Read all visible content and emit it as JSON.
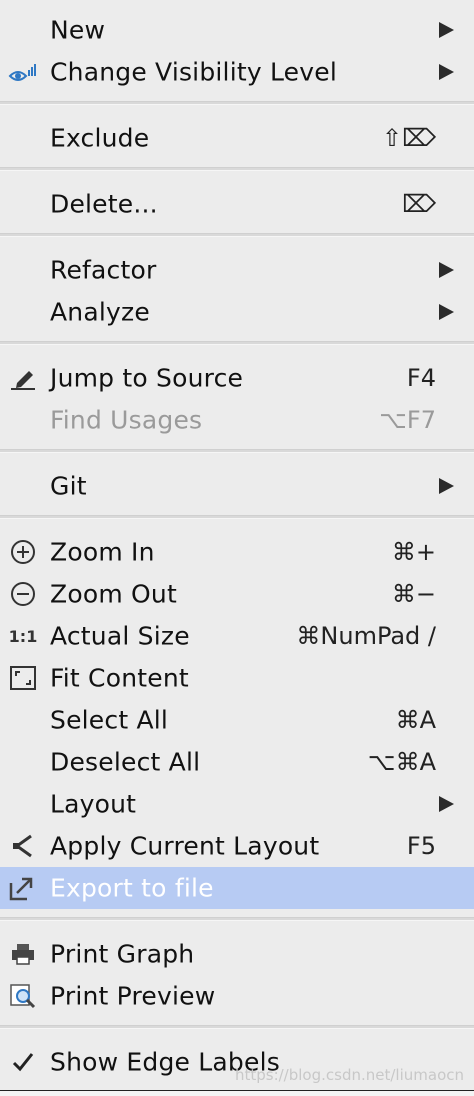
{
  "menu": {
    "new": {
      "label": "New"
    },
    "change_visibility": {
      "label": "Change Visibility Level"
    },
    "exclude": {
      "label": "Exclude",
      "shortcut": "⇧⌦"
    },
    "delete": {
      "label": "Delete...",
      "shortcut": "⌦"
    },
    "refactor": {
      "label": "Refactor"
    },
    "analyze": {
      "label": "Analyze"
    },
    "jump_to_source": {
      "label": "Jump to Source",
      "shortcut": "F4"
    },
    "find_usages": {
      "label": "Find Usages",
      "shortcut": "⌥F7"
    },
    "git": {
      "label": "Git"
    },
    "zoom_in": {
      "label": "Zoom In",
      "shortcut": "⌘+"
    },
    "zoom_out": {
      "label": "Zoom Out",
      "shortcut": "⌘−"
    },
    "actual_size": {
      "label": "Actual Size",
      "shortcut": "⌘NumPad /",
      "icon_text": "1:1"
    },
    "fit_content": {
      "label": "Fit Content"
    },
    "select_all": {
      "label": "Select All",
      "shortcut": "⌘A"
    },
    "deselect_all": {
      "label": "Deselect All",
      "shortcut": "⌥⌘A"
    },
    "layout": {
      "label": "Layout"
    },
    "apply_layout": {
      "label": "Apply Current Layout",
      "shortcut": "F5"
    },
    "export_to_file": {
      "label": "Export to file"
    },
    "print_graph": {
      "label": "Print Graph"
    },
    "print_preview": {
      "label": "Print Preview"
    },
    "show_edge_labels": {
      "label": "Show Edge Labels"
    }
  },
  "watermark": "https://blog.csdn.net/liumaocn",
  "colors": {
    "menu_bg": "#ececec",
    "highlight": "#b7cbf3",
    "disabled_text": "#9a9a9a",
    "icon_blue": "#2f78c4"
  }
}
